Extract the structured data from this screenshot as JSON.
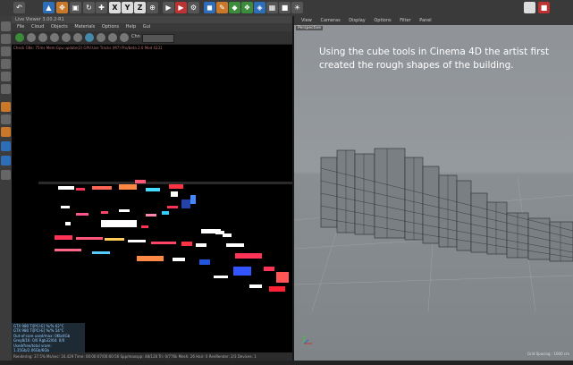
{
  "toolbar": {
    "axis_x": "X",
    "axis_y": "Y",
    "axis_z": "Z"
  },
  "viewer": {
    "title": "Live Viewer 3.00.2-R1",
    "menu": [
      "File",
      "Cloud",
      "Objects",
      "Materials",
      "Options",
      "Help",
      "Gui"
    ],
    "channel_label": "Chn",
    "info_line": "Check GNs: 75ms  Mem:Gpu update(2)  GPU:Use Tracks (M7) Pro/beta 2.0 Mod 4231",
    "stats": [
      "GTX 980 Ti[PCI-E]   %/%   62°C",
      "GTX 980 Ti[PCI-E]   %/%   54°C",
      "Out-of-core used/max: 0Kb/4Gb",
      "Grey8/16: 0/0     Rgb32/64: 0/0",
      "Used/free/total vram: 1.35Gb/2.06Gb/6Gb"
    ],
    "status": "Rendering: 37.5%   Ms/sec: 16.429   Time: 00:00:07/00:00:56   Spp/maxspp: 48/128   Tri: 0/776k   Mesh: 26   Hair: 0   RenRender: 2/3   Devices: 1"
  },
  "viewport": {
    "menu": [
      "View",
      "Cameras",
      "Display",
      "Options",
      "Filter",
      "Panel"
    ],
    "label": "Perspective",
    "caption": "Using the cube tools in Cinema 4D the artist first created the rough shapes of the building.",
    "grid_spacing": "Grid Spacing : 1000 cm"
  },
  "colors": {
    "caption": "#ffffff",
    "viewer_bg": "#000000",
    "viewport_bg": "#8f9397"
  }
}
